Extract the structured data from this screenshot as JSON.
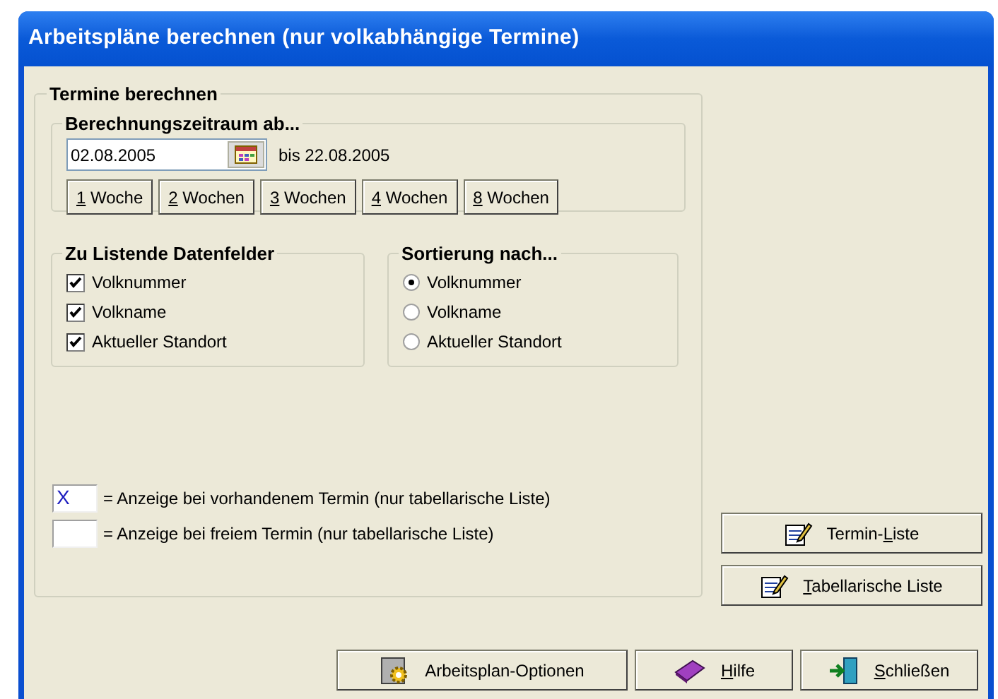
{
  "window": {
    "title": "Arbeitspläne berechnen (nur volkabhängige Termine)"
  },
  "termine_group": {
    "title": "Termine berechnen",
    "zeitraum": {
      "title": "Berechnungszeitraum ab...",
      "date_value": "02.08.2005",
      "end_text": "bis 22.08.2005",
      "week_buttons": [
        {
          "access_key": "1",
          "after": " Woche"
        },
        {
          "access_key": "2",
          "after": " Wochen"
        },
        {
          "access_key": "3",
          "after": " Wochen"
        },
        {
          "access_key": "4",
          "after": " Wochen"
        },
        {
          "access_key": "8",
          "after": " Wochen"
        }
      ]
    },
    "datenfelder": {
      "title": "Zu Listende Datenfelder",
      "items": [
        {
          "label": "Volknummer",
          "checked": true
        },
        {
          "label": "Volkname",
          "checked": true
        },
        {
          "label": "Aktueller Standort",
          "checked": true
        }
      ]
    },
    "sortierung": {
      "title": "Sortierung nach...",
      "options": [
        {
          "label": "Volknummer",
          "selected": true
        },
        {
          "label": "Volkname",
          "selected": false
        },
        {
          "label": "Aktueller Standort",
          "selected": false
        }
      ]
    },
    "legend": [
      {
        "sample": "X",
        "text": "= Anzeige bei vorhandenem Termin (nur tabellarische Liste)"
      },
      {
        "text": "= Anzeige bei freiem Termin (nur tabellarische Liste)"
      }
    ]
  },
  "list_buttons": [
    {
      "kind": "notepad",
      "before": "Termin-",
      "access_key": "L",
      "after": "iste"
    },
    {
      "kind": "notepad",
      "access_key": "T",
      "after": "abellarische Liste"
    }
  ],
  "footer_buttons": [
    {
      "kind": "gear",
      "after": "Arbeitsplan-Optionen"
    },
    {
      "kind": "book",
      "access_key": "H",
      "after": "ilfe"
    },
    {
      "kind": "door",
      "access_key": "S",
      "after": "chließen"
    }
  ]
}
